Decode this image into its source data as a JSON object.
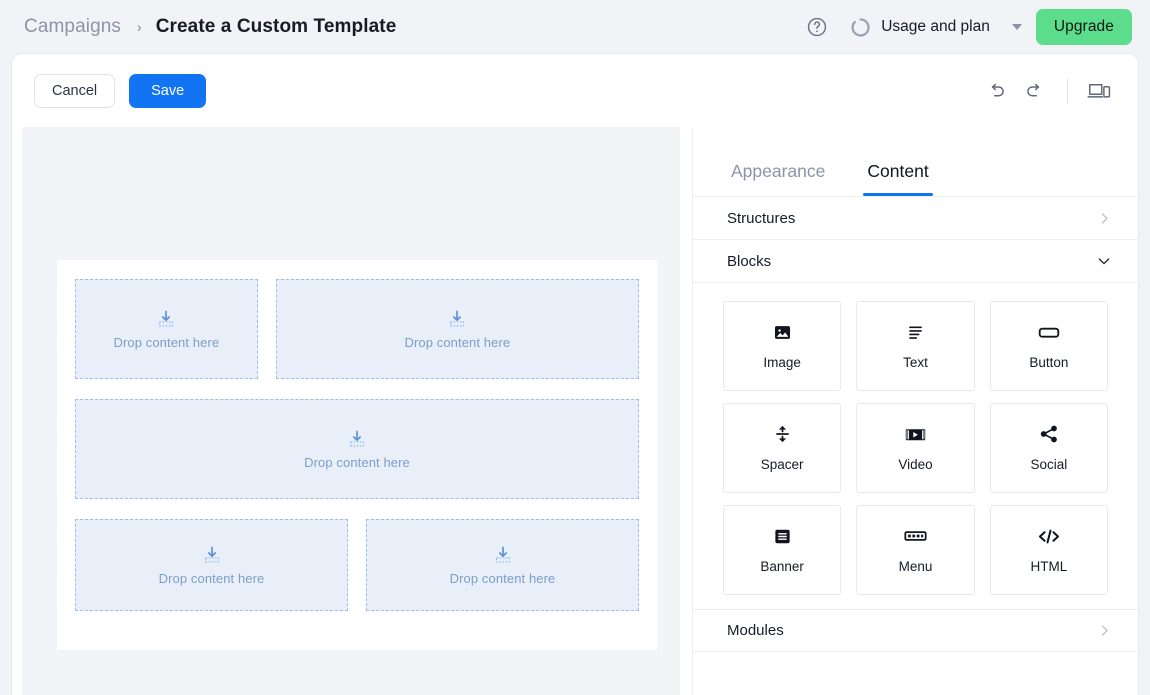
{
  "topbar": {
    "breadcrumb_root": "Campaigns",
    "breadcrumb_separator": "›",
    "breadcrumb_current": "Create a Custom Template",
    "help_icon": "question-circle-icon",
    "usage_icon": "usage-ring-icon",
    "usage_label": "Usage and plan",
    "usage_caret": "chevron-down-icon",
    "upgrade_label": "Upgrade",
    "upgrade_color": "#5cdd8b"
  },
  "toolbar": {
    "cancel_label": "Cancel",
    "save_label": "Save",
    "save_color": "#1273f3",
    "undo_icon": "undo-icon",
    "redo_icon": "redo-icon",
    "preview_icon": "device-preview-icon"
  },
  "canvas": {
    "rows": [
      {
        "zones": [
          {
            "label": "Drop content here",
            "span": 1,
            "icon": "drop-here-icon"
          },
          {
            "label": "Drop content here",
            "span": 2,
            "icon": "drop-here-icon"
          }
        ]
      },
      {
        "zones": [
          {
            "label": "Drop content here",
            "span": 1,
            "icon": "drop-here-icon"
          }
        ]
      },
      {
        "zones": [
          {
            "label": "Drop content here",
            "span": 1,
            "icon": "drop-here-icon"
          },
          {
            "label": "Drop content here",
            "span": 1,
            "icon": "drop-here-icon"
          }
        ]
      }
    ],
    "dropzone_fill": "#e8eff9",
    "dropzone_border": "#9cc0ea",
    "dropzone_text_color": "#7e9ec6"
  },
  "sidepanel": {
    "tabs": [
      {
        "label": "Appearance",
        "active": false
      },
      {
        "label": "Content",
        "active": true
      }
    ],
    "active_tab_color": "#1273f3",
    "sections": [
      {
        "title": "Structures",
        "expanded": false,
        "chevron": "chevron-right-icon"
      },
      {
        "title": "Blocks",
        "expanded": true,
        "chevron": "chevron-down-icon"
      },
      {
        "title": "Modules",
        "expanded": false,
        "chevron": "chevron-right-icon"
      }
    ],
    "blocks": [
      {
        "label": "Image",
        "icon": "image-icon"
      },
      {
        "label": "Text",
        "icon": "text-lines-icon"
      },
      {
        "label": "Button",
        "icon": "button-icon"
      },
      {
        "label": "Spacer",
        "icon": "spacer-icon"
      },
      {
        "label": "Video",
        "icon": "video-icon"
      },
      {
        "label": "Social",
        "icon": "share-icon"
      },
      {
        "label": "Banner",
        "icon": "banner-icon"
      },
      {
        "label": "Menu",
        "icon": "menu-icon"
      },
      {
        "label": "HTML",
        "icon": "code-icon"
      }
    ]
  }
}
